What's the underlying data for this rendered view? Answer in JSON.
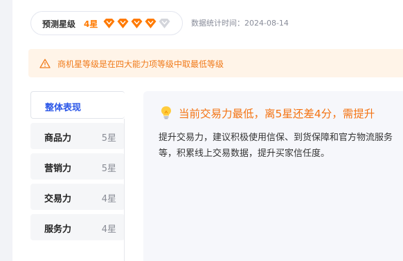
{
  "rating": {
    "title": "预测星级",
    "level": "4星",
    "stars_filled": 4,
    "stars_total": 5,
    "filled_color": "#ff7a00",
    "empty_color": "#d3d5db"
  },
  "stat_time": "数据统计时间：2024-08-14",
  "notice": {
    "icon": "warning-icon",
    "text": "商机星等级是在四大能力项等级中取最低等级"
  },
  "tabs": [
    {
      "label": "整体表现",
      "stars": ""
    },
    {
      "label": "商品力",
      "stars": "5星"
    },
    {
      "label": "营销力",
      "stars": "5星"
    },
    {
      "label": "交易力",
      "stars": "4星"
    },
    {
      "label": "服务力",
      "stars": "4星"
    }
  ],
  "active_tab": 0,
  "content": {
    "icon": "lightbulb-icon",
    "headline": "当前交易力最低，离5星还差4分，需提升",
    "body": "提升交易力，建议积极使用信保、到货保障和官方物流服务等，积累线上交易数据，提升买家信任度。"
  }
}
